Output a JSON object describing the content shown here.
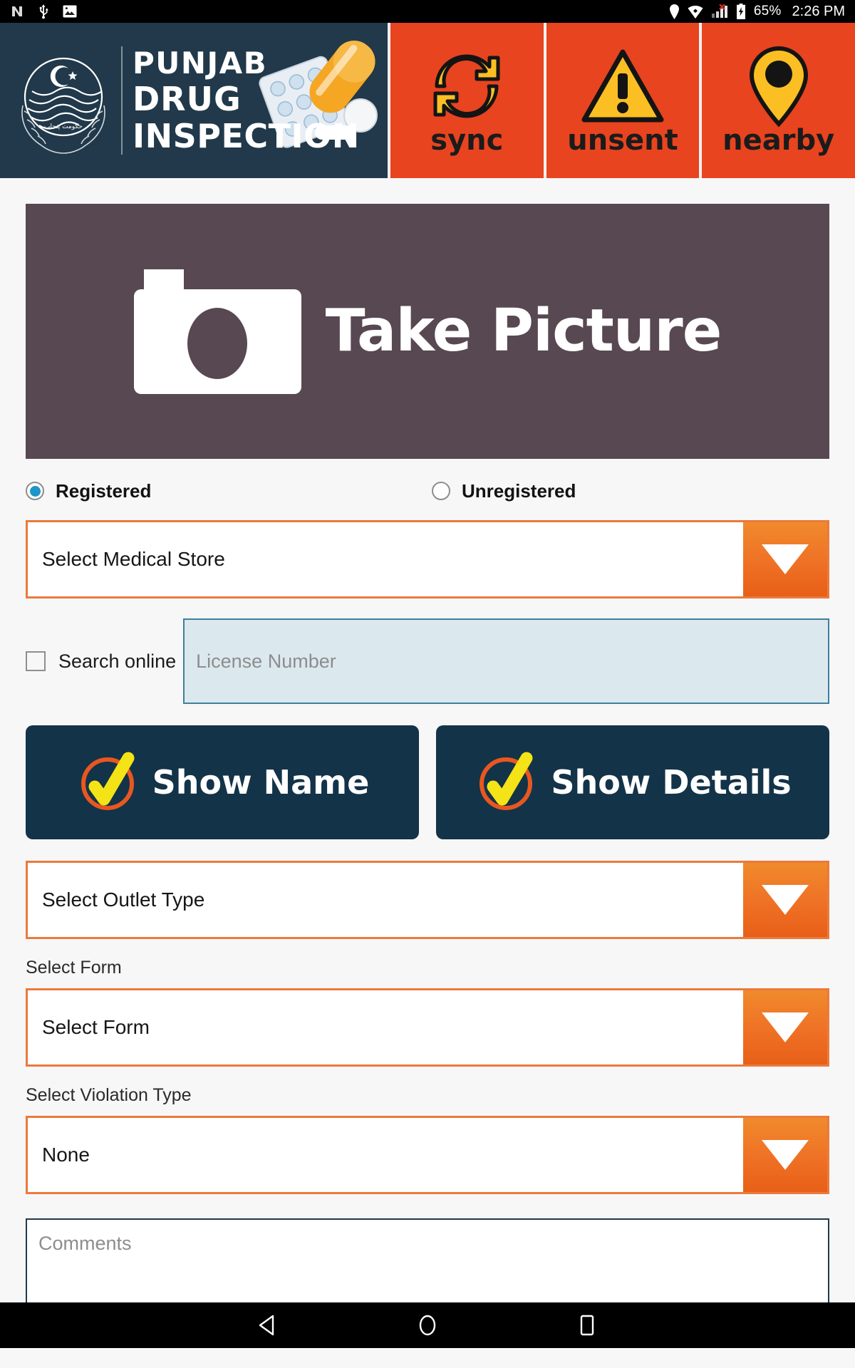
{
  "status_bar": {
    "left_icons": [
      "nfc-icon",
      "usb-icon",
      "image-icon"
    ],
    "right_icons": [
      "location-icon",
      "wifi-icon",
      "signal-icon",
      "battery-charging-icon"
    ],
    "battery": "65%",
    "time": "2:26 PM"
  },
  "header": {
    "brand": {
      "logo": "punjab-government-crest-icon",
      "line1": "PUNJAB",
      "line2": "DRUG",
      "line3": "INSPECTION",
      "artwork": "pills-blister-capsule-icon",
      "bg_color": "#21394a"
    },
    "buttons": [
      {
        "icon": "sync-icon",
        "label": "sync"
      },
      {
        "icon": "warning-icon",
        "label": "unsent"
      },
      {
        "icon": "map-pin-icon",
        "label": "nearby"
      }
    ],
    "button_bg_color": "#e8441f"
  },
  "main": {
    "take_picture": {
      "label": "Take Picture",
      "icon": "camera-icon",
      "bg_color": "#584851"
    },
    "registration": {
      "options": [
        {
          "label": "Registered",
          "selected": true
        },
        {
          "label": "Unregistered",
          "selected": false
        }
      ],
      "selected_color": "#1e96c8"
    },
    "medical_store": {
      "value": "Select Medical Store",
      "arrow": "chevron-down-icon"
    },
    "search_online": {
      "label": "Search online",
      "checked": false,
      "license_placeholder": "License Number",
      "license_value": ""
    },
    "actions": [
      {
        "label": "Show Name",
        "icon": "check-circle-icon"
      },
      {
        "label": "Show Details",
        "icon": "check-circle-icon"
      }
    ],
    "outlet_type": {
      "value": "Select Outlet Type",
      "arrow": "chevron-down-icon"
    },
    "form": {
      "label": "Select Form",
      "value": "Select Form",
      "arrow": "chevron-down-icon"
    },
    "violation_type": {
      "label": "Select Violation Type",
      "value": "None",
      "arrow": "chevron-down-icon"
    },
    "comments": {
      "placeholder": "Comments",
      "value": ""
    },
    "accent_orange": "#ef7326",
    "accent_dark": "#133349"
  },
  "nav_bar": {
    "back": "back-triangle-icon",
    "home": "home-circle-icon",
    "recents": "recents-square-icon"
  }
}
